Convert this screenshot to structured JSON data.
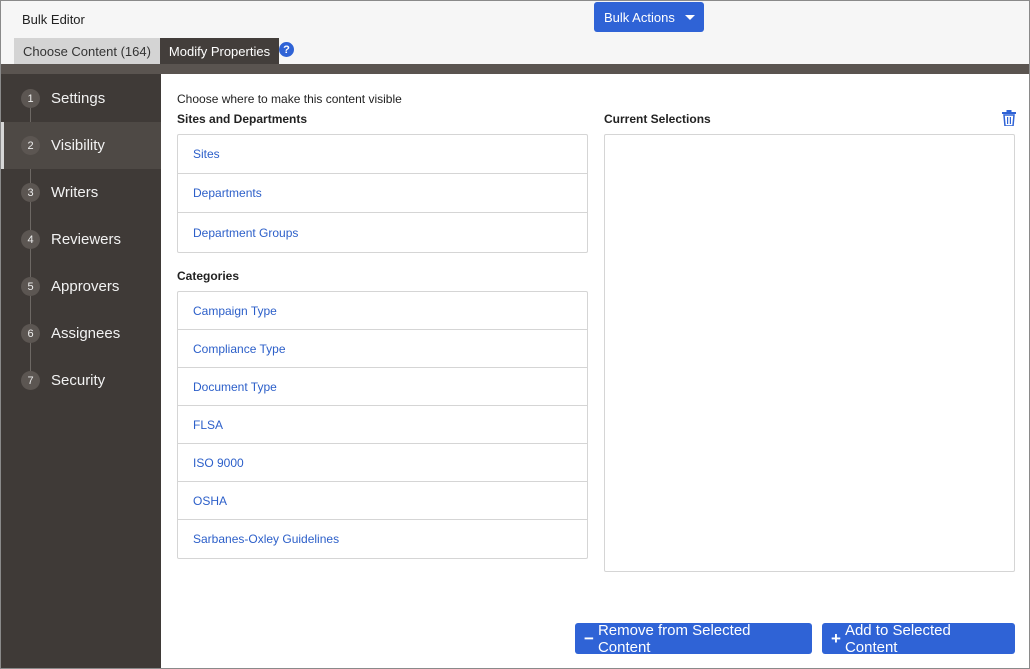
{
  "header": {
    "app_title": "Bulk Editor",
    "bulk_actions_label": "Bulk Actions",
    "tabs": [
      {
        "label": "Choose Content (164)",
        "active": false
      },
      {
        "label": "Modify Properties",
        "active": true
      }
    ],
    "help_glyph": "?"
  },
  "sidebar": {
    "steps": [
      {
        "num": "1",
        "label": "Settings"
      },
      {
        "num": "2",
        "label": "Visibility",
        "active": true
      },
      {
        "num": "3",
        "label": "Writers"
      },
      {
        "num": "4",
        "label": "Reviewers"
      },
      {
        "num": "5",
        "label": "Approvers"
      },
      {
        "num": "6",
        "label": "Assignees"
      },
      {
        "num": "7",
        "label": "Security"
      }
    ]
  },
  "main": {
    "intro": "Choose where to make this content visible",
    "sites_title": "Sites and Departments",
    "sites_items": [
      "Sites",
      "Departments",
      "Department Groups"
    ],
    "categories_title": "Categories",
    "categories_items": [
      "Campaign Type",
      "Compliance Type",
      "Document Type",
      "FLSA",
      "ISO 9000",
      "OSHA",
      "Sarbanes-Oxley Guidelines"
    ],
    "selections_title": "Current Selections",
    "remove_button_label": "Remove from Selected Content",
    "add_button_label": "Add to Selected Content"
  },
  "colors": {
    "accent": "#2f63d6",
    "link": "#2c5fc9",
    "sidebar_bg": "#3f3a37",
    "active_tab": "#433e3b"
  },
  "icons": {
    "help": "question-circle-icon",
    "trash": "trash-icon",
    "caret": "caret-down-icon"
  }
}
